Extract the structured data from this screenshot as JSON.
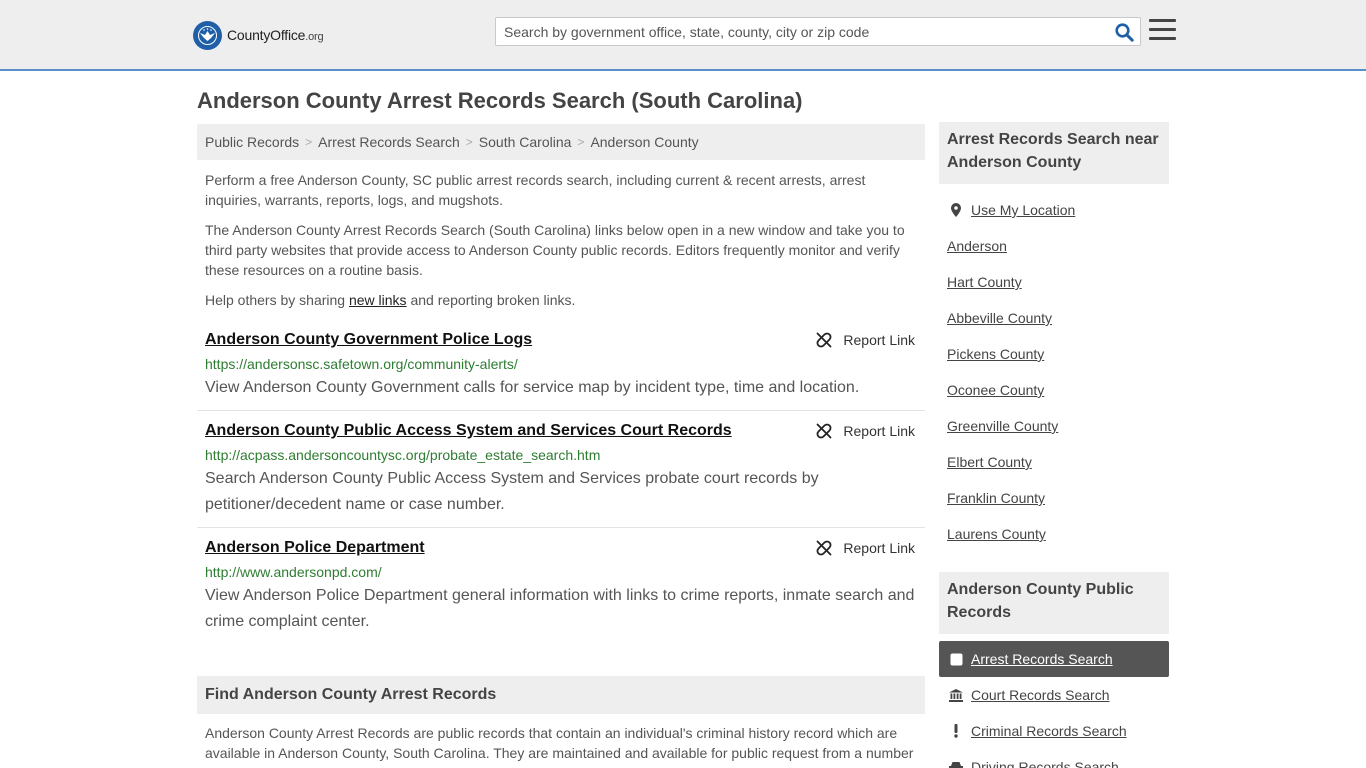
{
  "header": {
    "logo_name": "CountyOffice",
    "logo_tld": ".org",
    "search_placeholder": "Search by government office, state, county, city or zip code"
  },
  "page": {
    "title": "Anderson County Arrest Records Search (South Carolina)"
  },
  "breadcrumb": [
    "Public Records",
    "Arrest Records Search",
    "South Carolina",
    "Anderson County"
  ],
  "intro": {
    "p1": "Perform a free Anderson County, SC public arrest records search, including current & recent arrests, arrest inquiries, warrants, reports, logs, and mugshots.",
    "p2": "The Anderson County Arrest Records Search (South Carolina) links below open in a new window and take you to third party websites that provide access to Anderson County public records. Editors frequently monitor and verify these resources on a routine basis.",
    "p3_before": "Help others by sharing ",
    "p3_link": "new links",
    "p3_after": " and reporting broken links."
  },
  "results": [
    {
      "title": "Anderson County Government Police Logs",
      "url": "https://andersonsc.safetown.org/community-alerts/",
      "desc": "View Anderson County Government calls for service map by incident type, time and location.",
      "report": "Report Link"
    },
    {
      "title": "Anderson County Public Access System and Services Court Records",
      "url": "http://acpass.andersoncountysc.org/probate_estate_search.htm",
      "desc": "Search Anderson County Public Access System and Services probate court records by petitioner/decedent name or case number.",
      "report": "Report Link"
    },
    {
      "title": "Anderson Police Department",
      "url": "http://www.andersonpd.com/",
      "desc": "View Anderson Police Department general information with links to crime reports, inmate search and crime complaint center.",
      "report": "Report Link"
    }
  ],
  "find": {
    "heading": "Find Anderson County Arrest Records",
    "text": "Anderson County Arrest Records are public records that contain an individual's criminal history record which are available in Anderson County, South Carolina. They are maintained and available for public request from a number"
  },
  "sidebar": {
    "near_heading": "Arrest Records Search near Anderson County",
    "use_location": "Use My Location",
    "near_links": [
      "Anderson",
      "Hart County",
      "Abbeville County",
      "Pickens County",
      "Oconee County",
      "Greenville County",
      "Elbert County",
      "Franklin County",
      "Laurens County"
    ],
    "public_heading": "Anderson County Public Records",
    "public_links": [
      {
        "label": "Arrest Records Search",
        "icon": "square-icon"
      },
      {
        "label": "Court Records Search",
        "icon": "courthouse-icon"
      },
      {
        "label": "Criminal Records Search",
        "icon": "exclamation-icon"
      },
      {
        "label": "Driving Records Search",
        "icon": "car-icon"
      }
    ]
  },
  "colors": {
    "header_bg": "#eeeeee",
    "header_border": "#5b8fc9",
    "logo_blue": "#1f5fa8",
    "search_icon": "#1f5fa8",
    "url_green": "#2e7d32",
    "active_item_bg": "#555555"
  }
}
